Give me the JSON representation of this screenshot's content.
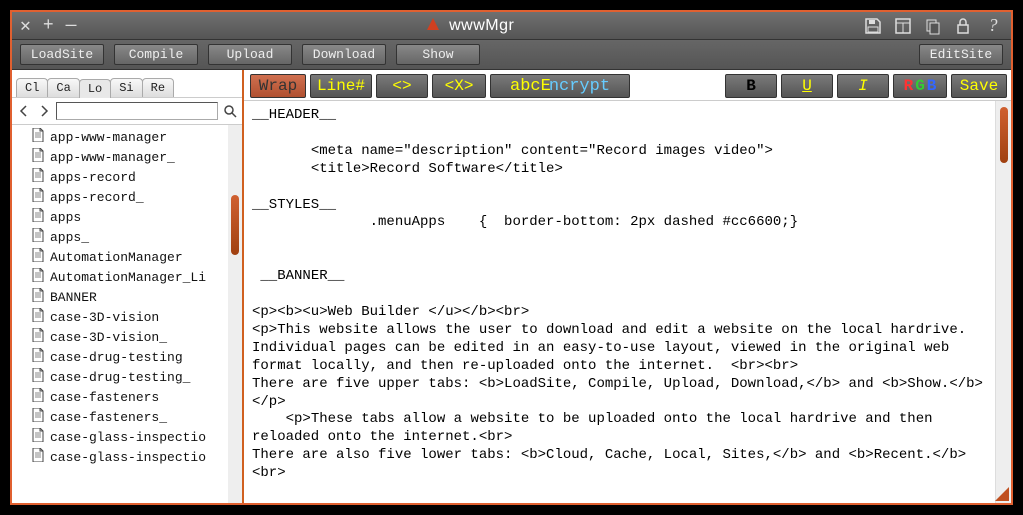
{
  "window": {
    "close_glyph": "✕",
    "add_glyph": "+",
    "min_glyph": "—",
    "app_title": "wwwMgr"
  },
  "right_icons": [
    "save-icon",
    "layout-icon",
    "copy-icon",
    "lock-icon",
    "help-icon"
  ],
  "topbar": {
    "btn_loadsite": "LoadSite",
    "btn_compile": "Compile",
    "btn_upload": "Upload",
    "btn_download": "Download",
    "btn_show": "Show",
    "btn_editsite": "EditSite"
  },
  "tabs": {
    "cl": "Cl",
    "ca": "Ca",
    "lo": "Lo",
    "si": "Si",
    "re": "Re",
    "active": "lo"
  },
  "search": {
    "value": ""
  },
  "files": [
    "app-www-manager",
    "app-www-manager_",
    "apps-record",
    "apps-record_",
    "apps",
    "apps_",
    "AutomationManager",
    "AutomationManager_Li",
    "BANNER",
    "case-3D-vision",
    "case-3D-vision_",
    "case-drug-testing",
    "case-drug-testing_",
    "case-fasteners",
    "case-fasteners_",
    "case-glass-inspectio",
    "case-glass-inspectio"
  ],
  "tool": {
    "wrap": "Wrap",
    "line": "Line#",
    "tag": "<>",
    "xtag": "<X>",
    "abc_half1": "abcE",
    "abc_half2": "ncrypt",
    "b": "B",
    "u": "U",
    "i": "I",
    "r": "R",
    "g": "G",
    "b2": "B",
    "save": "Save"
  },
  "editor_text": "__HEADER__\n\n       <meta name=\"description\" content=\"Record images video\">\n       <title>Record Software</title>\n\n__STYLES__\n              .menuApps    {  border-bottom: 2px dashed #cc6600;}\n\n\n __BANNER__\n\n<p><b><u>Web Builder </u></b><br>\n<p>This website allows the user to download and edit a website on the local hardrive.  Individual pages can be edited in an easy-to-use layout, viewed in the original web format locally, and then re-uploaded onto the internet.  <br><br>\nThere are five upper tabs: <b>LoadSite, Compile, Upload, Download,</b> and <b>Show.</b></p>\n    <p>These tabs allow a website to be uploaded onto the local hardrive and then reloaded onto the internet.<br>\nThere are also five lower tabs: <b>Cloud, Cache, Local, Sites,</b> and <b>Recent.</b><br>"
}
